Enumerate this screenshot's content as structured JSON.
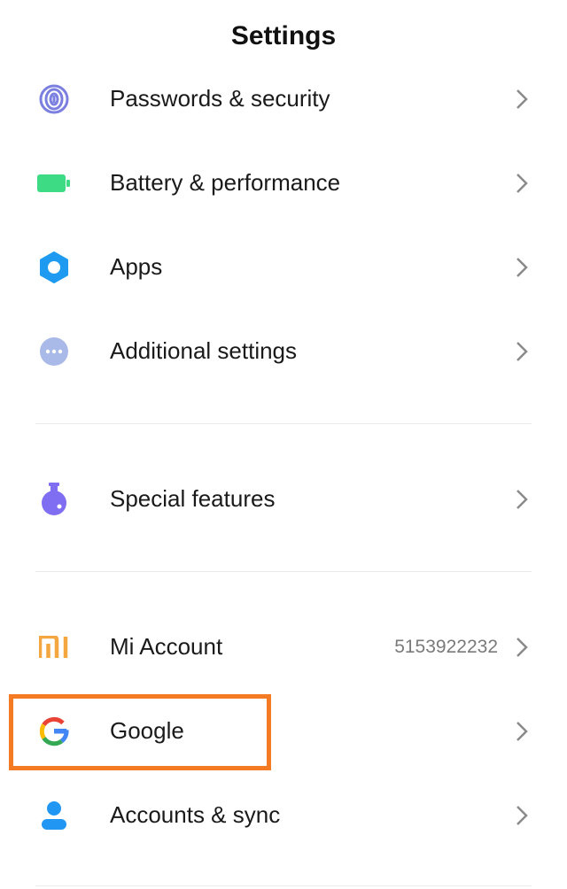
{
  "header": {
    "title": "Settings"
  },
  "items": [
    {
      "label": "Passwords & security",
      "icon": "fingerprint-icon",
      "color": "#7b7fe0"
    },
    {
      "label": "Battery & performance",
      "icon": "battery-icon",
      "color": "#3ddc84"
    },
    {
      "label": "Apps",
      "icon": "gear-icon",
      "color": "#1e9bf0"
    },
    {
      "label": "Additional settings",
      "icon": "more-dots-icon",
      "color": "#a9b9e8"
    },
    {
      "label": "Special features",
      "icon": "flask-icon",
      "color": "#7f6ef2"
    },
    {
      "label": "Mi Account",
      "icon": "mi-logo-icon",
      "color": "#f4a640",
      "value": "5153922232"
    },
    {
      "label": "Google",
      "icon": "google-icon",
      "color": "#4285f4"
    },
    {
      "label": "Accounts & sync",
      "icon": "person-icon",
      "color": "#2196f3"
    }
  ],
  "highlight": {
    "target": "Google",
    "color": "#f57a24"
  }
}
